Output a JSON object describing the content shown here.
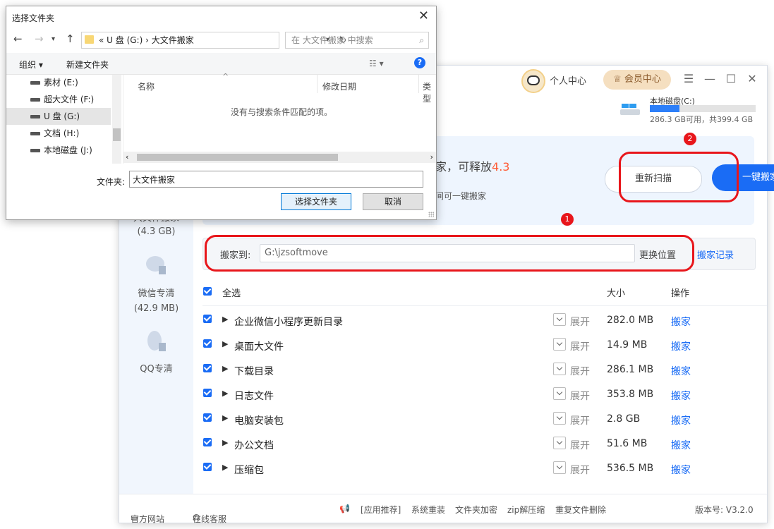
{
  "app": {
    "personal_center": "个人中心",
    "vip_center": "会员中心",
    "disk": {
      "name": "本地磁盘(C:)",
      "info": "286.3 GB可用，共399.4 GB",
      "used_fraction": 0.28
    },
    "banner": {
      "text_prefix": "家，可释放",
      "text_value": "4.3",
      "sub": "间可一键搬家"
    },
    "rescan_label": "重新扫描",
    "onekey_label": "一键搬家",
    "badge1": "1",
    "badge2": "2",
    "move_to": {
      "label": "搬家到:",
      "value": "G:\\jzsoftmove",
      "change": "更换位置",
      "records": "搬家记录"
    },
    "sidebar": [
      {
        "label": "大文件搬家",
        "sub": "(4.3 GB)"
      },
      {
        "label": "微信专清",
        "sub": "(42.9 MB)"
      },
      {
        "label": "QQ专清",
        "sub": ""
      }
    ],
    "table": {
      "select_all": "全选",
      "col_size": "大小",
      "col_action": "操作",
      "expand_label": "展开",
      "action_label": "搬家",
      "rows": [
        {
          "name": "企业微信小程序更新目录",
          "size": "282.0 MB"
        },
        {
          "name": "桌面大文件",
          "size": "14.9 MB"
        },
        {
          "name": "下载目录",
          "size": "286.1 MB"
        },
        {
          "name": "日志文件",
          "size": "353.8 MB"
        },
        {
          "name": "电脑安装包",
          "size": "2.8 GB"
        },
        {
          "name": "办公文档",
          "size": "51.6 MB"
        },
        {
          "name": "压缩包",
          "size": "536.5 MB"
        }
      ]
    },
    "footer": {
      "website": "官方网站",
      "support": "在线客服",
      "recommend": "[应用推荐]",
      "reinstall": "系统重装",
      "encrypt": "文件夹加密",
      "zip": "zip解压缩",
      "dedupe": "重复文件删除",
      "version": "版本号: V3.2.0"
    }
  },
  "dialog": {
    "title": "选择文件夹",
    "breadcrumb": "«  U 盘 (G:)  ›  大文件搬家",
    "search_placeholder": "在 大文件搬家 中搜索",
    "organize": "组织 ▾",
    "new_folder": "新建文件夹",
    "help": "?",
    "tree": [
      {
        "label": "素材 (E:)"
      },
      {
        "label": "超大文件 (F:)"
      },
      {
        "label": "U 盘 (G:)"
      },
      {
        "label": "文档 (H:)"
      },
      {
        "label": "本地磁盘 (J:)"
      }
    ],
    "columns": [
      "名称",
      "修改日期",
      "类型"
    ],
    "empty_text": "没有与搜索条件匹配的项。",
    "folder_label": "文件夹:",
    "folder_value": "大文件搬家",
    "select_button": "选择文件夹",
    "cancel_button": "取消"
  }
}
